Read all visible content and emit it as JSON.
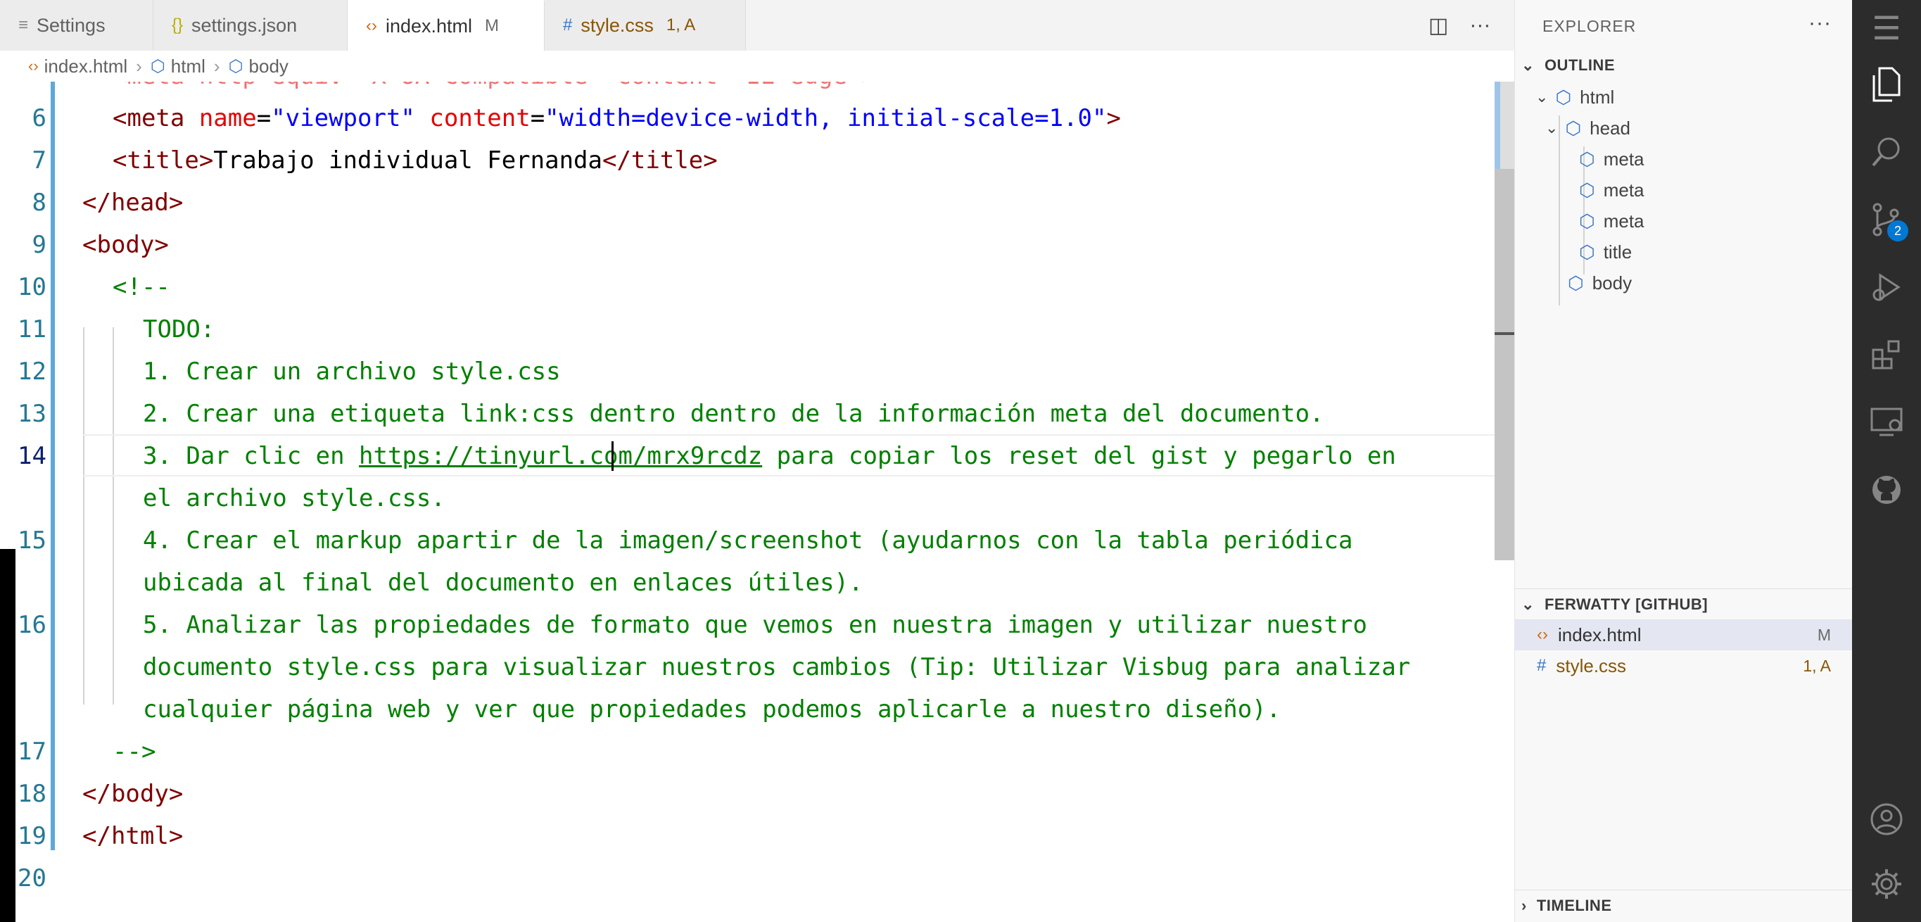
{
  "tabs": [
    {
      "label": "Settings",
      "icon": "settings-file-icon",
      "badge": ""
    },
    {
      "label": "settings.json",
      "icon": "braces-icon",
      "badge": ""
    },
    {
      "label": "index.html",
      "icon": "html-file-icon",
      "badge": "M"
    },
    {
      "label": "style.css",
      "icon": "hash-icon",
      "badge": "1, A"
    }
  ],
  "breadcrumb": [
    "index.html",
    "html",
    "body"
  ],
  "editor": {
    "line_numbers": [
      "6",
      "7",
      "8",
      "9",
      "10",
      "11",
      "12",
      "13",
      "14",
      "",
      "15",
      "",
      "16",
      "",
      "",
      "17",
      "18",
      "19",
      "20"
    ],
    "current_line": "14",
    "partial_top_line": "<meta http-equiv=\"X-UA-Compatible\" content=\"IE=edge\">",
    "line6": {
      "open": "<meta ",
      "attr1": "name",
      "eq1": "=",
      "val1": "\"viewport\"",
      "sp": " ",
      "attr2": "content",
      "eq2": "=",
      "val2": "\"width=device-width, initial-scale=1.0\"",
      "close": ">"
    },
    "line7": {
      "open": "<title>",
      "text": "Trabajo individual Fernanda",
      "close": "</title>"
    },
    "line8": "</head>",
    "line9": "<body>",
    "line10": "<!--",
    "line11": "TODO:",
    "line12": "1. Crear un archivo style.css",
    "line13": "2. Crear una etiqueta link:css dentro dentro de la información meta del documento.",
    "line14a": "3. Dar clic en ",
    "line14_link": "https://tinyurl.com/mrx9rcdz",
    "line14b": " para copiar los reset del gist y pegarlo en",
    "line14c": "el archivo style.css.",
    "line15a": "4. Crear el markup apartir de la imagen/screenshot (ayudarnos con la tabla periódica",
    "line15b": "ubicada al final del documento en enlaces útiles).",
    "line16a": "5. Analizar las propiedades de formato que vemos en nuestra imagen y utilizar nuestro",
    "line16b": "documento style.css para visualizar nuestros cambios (Tip: Utilizar Visbug para analizar",
    "line16c": "cualquier página web y ver que propiedades podemos aplicarle a nuestro diseño).",
    "line17": "-->",
    "line18": "</body>",
    "line19": "</html>"
  },
  "sidebar": {
    "title": "EXPLORER",
    "more": "···",
    "outline": {
      "title": "OUTLINE",
      "items": [
        "html",
        "head",
        "meta",
        "meta",
        "meta",
        "title",
        "body"
      ]
    },
    "repo": {
      "title": "FERWATTY [GITHUB]",
      "files": [
        {
          "name": "index.html",
          "status": "M",
          "color": "#333333",
          "status_color": "#6c6c6c"
        },
        {
          "name": "style.css",
          "status": "1, A",
          "color": "#895503",
          "status_color": "#895503"
        }
      ]
    },
    "timeline": {
      "title": "TIMELINE"
    }
  },
  "activity_bar": {
    "scm_badge": "2"
  },
  "colors": {
    "tag": "#800000",
    "attribute": "#e50000",
    "string": "#0000ff",
    "comment": "#008000",
    "line_number": "#237893",
    "activity_bar": "#2c2c2c"
  }
}
